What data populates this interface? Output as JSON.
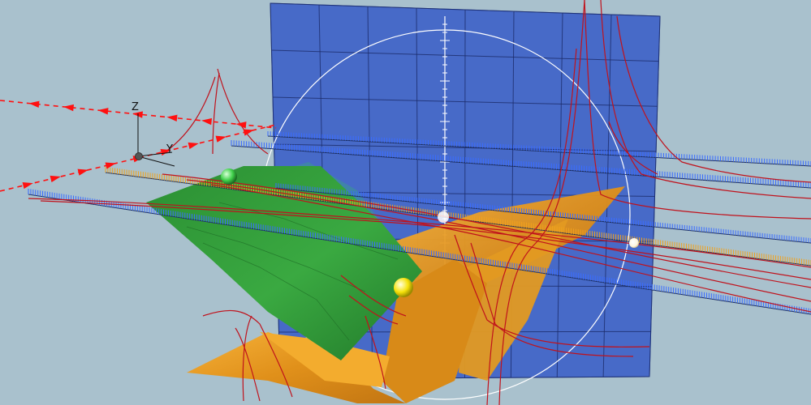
{
  "scene": {
    "background": "#a9c1cd",
    "axes": {
      "labels": {
        "z": "Z",
        "y": "Y"
      },
      "color": "#111111",
      "origin_marker_color": "#555555"
    },
    "surfaces": [
      {
        "name": "vertical-plane",
        "color": "#3f63c8"
      },
      {
        "name": "green-sheet",
        "color": "#2e9a36"
      },
      {
        "name": "orange-sheet",
        "color": "#f0a21e"
      },
      {
        "name": "teal-patch",
        "color": "#3f86a6"
      }
    ],
    "curves": {
      "field_line_color": "#c0121c",
      "arrow_color": "#ff1010"
    },
    "rulers": {
      "blue": "#3a6cff",
      "orange": "#f0a21e"
    },
    "spheres": [
      {
        "name": "green-sphere",
        "color": "#3fd04a"
      },
      {
        "name": "yellow-sphere",
        "color": "#f6e20a"
      },
      {
        "name": "white-sphere-right",
        "color": "#fff4dc"
      },
      {
        "name": "white-sphere-center",
        "color": "#ffffff"
      }
    ],
    "overlay": {
      "circle_color": "#ffffff",
      "grid_color": "#1c2c6a"
    }
  }
}
